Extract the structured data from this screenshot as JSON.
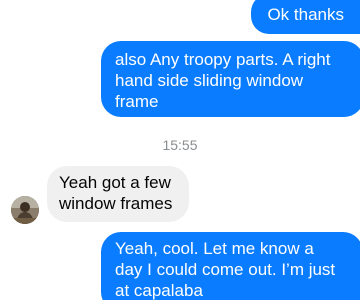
{
  "conversation": {
    "messages": [
      {
        "sender": "me",
        "text": "Ok thanks"
      },
      {
        "sender": "me",
        "text": "also Any troopy parts. A right\nhand side sliding window\nframe"
      },
      {
        "sender": "them",
        "text": "Yeah got a few\nwindow frames"
      },
      {
        "sender": "me",
        "text": "Yeah, cool. Let me know a\nday I could come out. I’m just\nat capalaba"
      }
    ],
    "timestamp": "15:55"
  },
  "colors": {
    "sent_bubble": "#0a7cff",
    "received_bubble": "#f0f0f0",
    "timestamp_text": "#8a8d91"
  }
}
